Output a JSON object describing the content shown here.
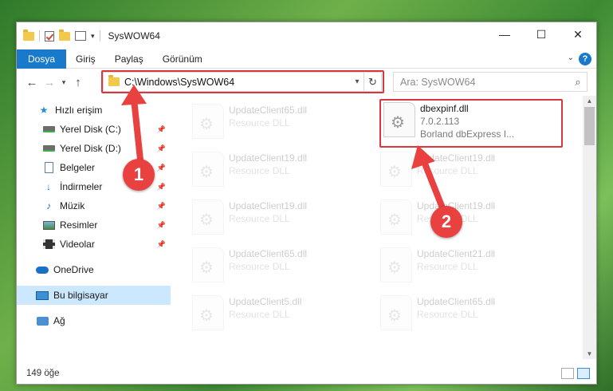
{
  "window": {
    "title": "SysWOW64",
    "controls": {
      "minimize": "—",
      "maximize": "☐",
      "close": "✕"
    }
  },
  "ribbon": {
    "tabs": [
      "Dosya",
      "Giriş",
      "Paylaş",
      "Görünüm"
    ],
    "help": "?"
  },
  "nav": {
    "address": "C:\\Windows\\SysWOW64",
    "search_placeholder": "Ara: SysWOW64"
  },
  "sidebar": {
    "items": [
      {
        "label": "Hızlı erişim",
        "icon": "star-icon"
      },
      {
        "label": "Yerel Disk (C:)",
        "icon": "drive-icon"
      },
      {
        "label": "Yerel Disk (D:)",
        "icon": "drive-icon"
      },
      {
        "label": "Belgeler",
        "icon": "documents-icon"
      },
      {
        "label": "İndirmeler",
        "icon": "download-icon"
      },
      {
        "label": "Müzik",
        "icon": "music-icon"
      },
      {
        "label": "Resimler",
        "icon": "pictures-icon"
      },
      {
        "label": "Videolar",
        "icon": "videos-icon"
      },
      {
        "label": "OneDrive",
        "icon": "onedrive-icon"
      },
      {
        "label": "Bu bilgisayar",
        "icon": "this-pc-icon"
      },
      {
        "label": "Ağ",
        "icon": "network-icon"
      }
    ]
  },
  "files": {
    "highlighted": {
      "name": "dbexpinf.dll",
      "version": "7.0.2.113",
      "description": "Borland dbExpress I..."
    },
    "faded": [
      {
        "name": "UpdateClient65.dll",
        "type": "Resource DLL"
      },
      {
        "name": "UpdateClient19.dll",
        "type": "Resource DLL"
      },
      {
        "name": "UpdateClient19.dll",
        "type": "Resource DLL"
      },
      {
        "name": "UpdateClient19.dll",
        "type": "Resource DLL"
      },
      {
        "name": "UpdateClient19.dll",
        "type": "Resource DLL"
      },
      {
        "name": "UpdateClient65.dll",
        "type": "Resource DLL"
      },
      {
        "name": "UpdateClient21.dll",
        "type": "Resource DLL"
      },
      {
        "name": "UpdateClient5.dll",
        "type": "Resource DLL"
      },
      {
        "name": "UpdateClient65.dll",
        "type": "Resource DLL"
      }
    ]
  },
  "status": {
    "count": "149 öğe"
  },
  "annotations": {
    "step1": "1",
    "step2": "2",
    "color": "#e8413f"
  }
}
